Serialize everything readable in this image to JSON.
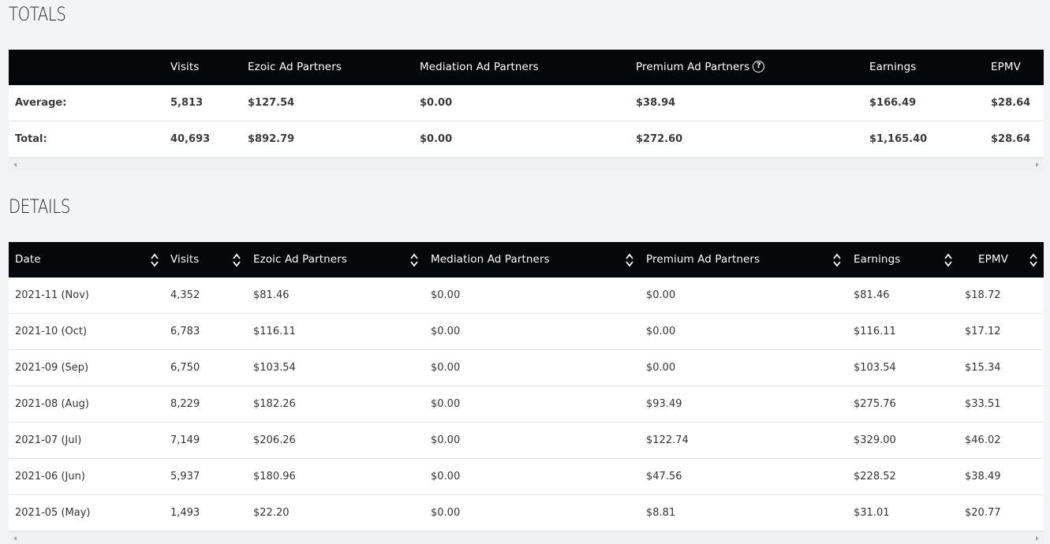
{
  "totals": {
    "title": "TOTALS",
    "headers": [
      "",
      "Visits",
      "Ezoic Ad Partners",
      "Mediation Ad Partners",
      "Premium Ad Partners",
      "Earnings",
      "EPMV"
    ],
    "rows": [
      [
        "Average:",
        "5,813",
        "$127.54",
        "$0.00",
        "$38.94",
        "$166.49",
        "$28.64"
      ],
      [
        "Total:",
        "40,693",
        "$892.79",
        "$0.00",
        "$272.60",
        "$1,165.40",
        "$28.64"
      ]
    ],
    "help_glyph": "?"
  },
  "details": {
    "title": "DETAILS",
    "headers": [
      "Date",
      "Visits",
      "Ezoic Ad Partners",
      "Mediation Ad Partners",
      "Premium Ad Partners",
      "Earnings",
      "EPMV"
    ],
    "rows": [
      [
        "2021-11 (Nov)",
        "4,352",
        "$81.46",
        "$0.00",
        "$0.00",
        "$81.46",
        "$18.72"
      ],
      [
        "2021-10 (Oct)",
        "6,783",
        "$116.11",
        "$0.00",
        "$0.00",
        "$116.11",
        "$17.12"
      ],
      [
        "2021-09 (Sep)",
        "6,750",
        "$103.54",
        "$0.00",
        "$0.00",
        "$103.54",
        "$15.34"
      ],
      [
        "2021-08 (Aug)",
        "8,229",
        "$182.26",
        "$0.00",
        "$93.49",
        "$275.76",
        "$33.51"
      ],
      [
        "2021-07 (Jul)",
        "7,149",
        "$206.26",
        "$0.00",
        "$122.74",
        "$329.00",
        "$46.02"
      ],
      [
        "2021-06 (Jun)",
        "5,937",
        "$180.96",
        "$0.00",
        "$47.56",
        "$228.52",
        "$38.49"
      ],
      [
        "2021-05 (May)",
        "1,493",
        "$22.20",
        "$0.00",
        "$8.81",
        "$31.01",
        "$20.77"
      ]
    ]
  },
  "icons": {
    "sort": "sort-updown-icon",
    "help": "question-circle-icon",
    "scroll_left": "scroll-left-icon",
    "scroll_right": "scroll-right-icon"
  },
  "colors": {
    "header_bg": "#05080b",
    "page_bg": "#f3f4f5",
    "row_border": "#e6e6e6"
  }
}
